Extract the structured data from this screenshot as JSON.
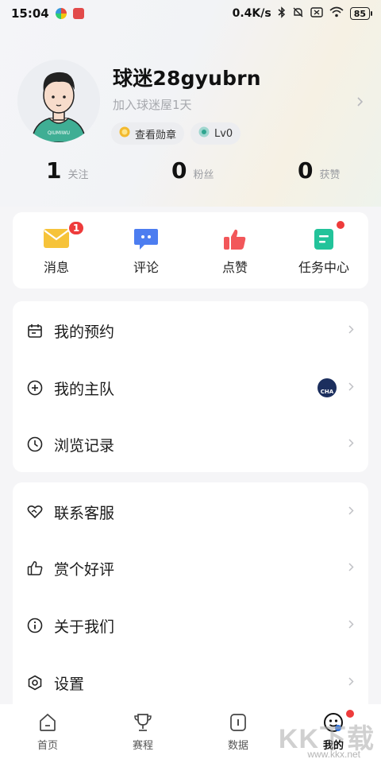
{
  "status_bar": {
    "time": "15:04",
    "network_speed": "0.4K/s",
    "battery": "85"
  },
  "profile": {
    "username": "球迷28gyubrn",
    "subtitle": "加入球迷屋1天",
    "medal_label": "查看勋章",
    "level_label": "Lv0"
  },
  "stats": [
    {
      "value": "1",
      "label": "关注"
    },
    {
      "value": "0",
      "label": "粉丝"
    },
    {
      "value": "0",
      "label": "获赞"
    }
  ],
  "quick_actions": [
    {
      "label": "消息",
      "badge": "1",
      "icon": "envelope-icon"
    },
    {
      "label": "评论",
      "icon": "comment-icon"
    },
    {
      "label": "点赞",
      "icon": "thumbs-up-icon"
    },
    {
      "label": "任务中心",
      "icon": "task-icon",
      "dot": true
    }
  ],
  "menu_group_1": [
    {
      "label": "我的预约",
      "icon": "calendar-icon"
    },
    {
      "label": "我的主队",
      "icon": "plus-circle-icon",
      "team_badge": "CHA"
    },
    {
      "label": "浏览记录",
      "icon": "clock-icon"
    }
  ],
  "menu_group_2": [
    {
      "label": "联系客服",
      "icon": "heart-handshake-icon"
    },
    {
      "label": "赏个好评",
      "icon": "thumbs-up-outline-icon"
    },
    {
      "label": "关于我们",
      "icon": "info-icon"
    },
    {
      "label": "设置",
      "icon": "settings-icon"
    }
  ],
  "tabbar": [
    {
      "label": "首页",
      "icon": "home-icon"
    },
    {
      "label": "赛程",
      "icon": "trophy-icon"
    },
    {
      "label": "数据",
      "icon": "data-icon"
    },
    {
      "label": "我的",
      "icon": "profile-face-icon",
      "active": true
    }
  ],
  "colors": {
    "accent_red": "#ee3b3b",
    "envelope": "#f6c33a",
    "comment": "#4c7df0",
    "like": "#f2575a",
    "task": "#22c39a"
  },
  "watermark": {
    "text": "KK下载",
    "url": "www.kkx.net"
  }
}
